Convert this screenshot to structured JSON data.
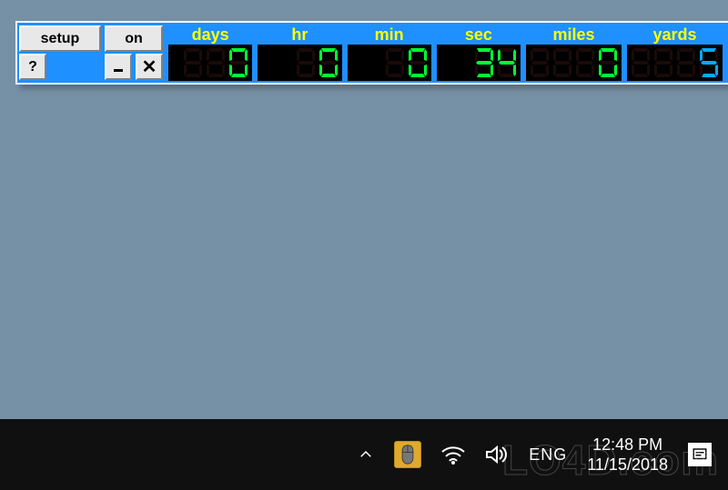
{
  "app": {
    "buttons": {
      "setup": "setup",
      "toggle": "on",
      "help": "?",
      "minimize": "_",
      "close": "x"
    },
    "panels": [
      {
        "key": "days",
        "label": "days",
        "value": 0,
        "digits": 3,
        "color": "green"
      },
      {
        "key": "hr",
        "label": "hr",
        "value": 0,
        "digits": 2,
        "color": "green"
      },
      {
        "key": "min",
        "label": "min",
        "value": 0,
        "digits": 2,
        "color": "green"
      },
      {
        "key": "sec",
        "label": "sec",
        "value": 34,
        "digits": 2,
        "color": "green"
      },
      {
        "key": "miles",
        "label": "miles",
        "value": 0,
        "digits": 4,
        "color": "green"
      },
      {
        "key": "yards",
        "label": "yards",
        "value": 5,
        "digits": 4,
        "color": "blue"
      }
    ]
  },
  "taskbar": {
    "language": "ENG",
    "time": "12:48 PM",
    "date": "11/15/2018"
  },
  "watermark": "LO4D.com"
}
